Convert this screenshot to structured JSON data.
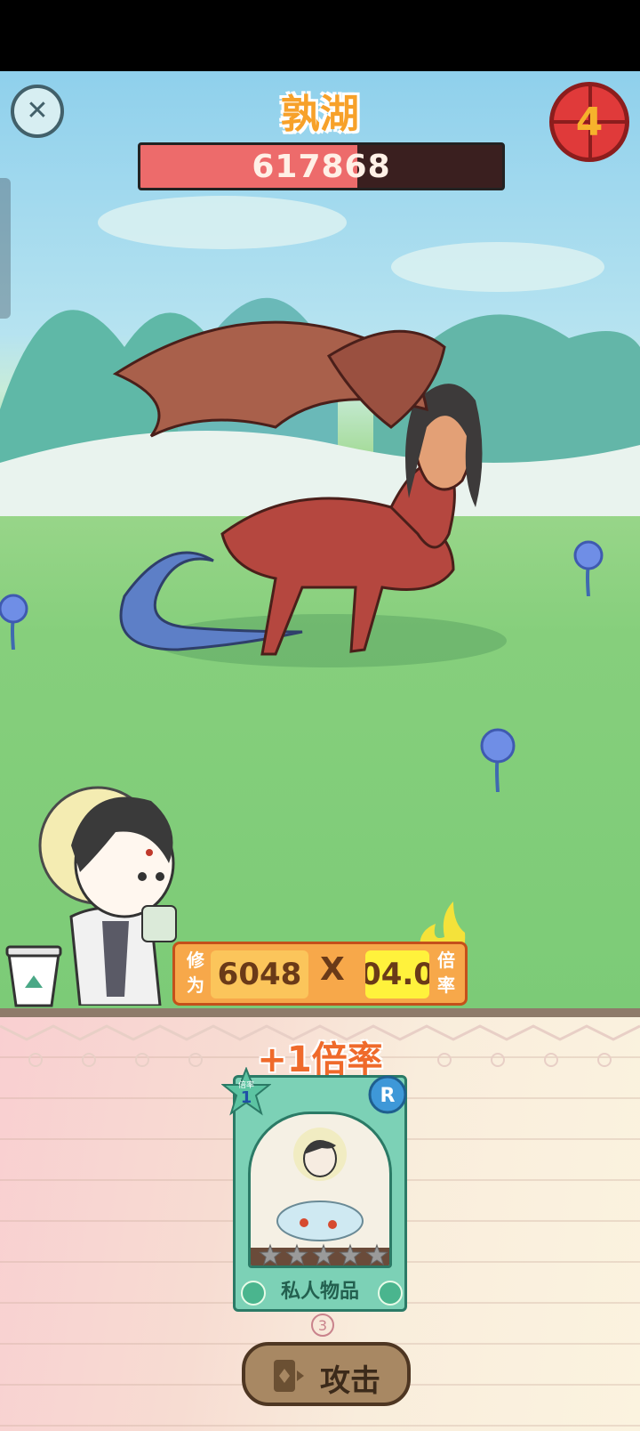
{
  "boss": {
    "name": "孰湖",
    "hp_value": "617868",
    "hp_fraction": 0.6
  },
  "round": {
    "number": "4"
  },
  "stats": {
    "cultivation_label": "修为",
    "cultivation_value": "6048",
    "times_sign": "X",
    "multiplier_label": "倍率",
    "multiplier_value": "04.0"
  },
  "bonus_text": "+1倍率",
  "card": {
    "badge_label": "倍率",
    "badge_value": "1",
    "rarity": "R",
    "title": "私人物品",
    "stars_total": 5,
    "stars_filled": 0
  },
  "deck_count": "3",
  "attack_label": "攻击",
  "colors": {
    "hp_fill": "#ed6b6b",
    "round_badge": "#e03a3a",
    "card_green": "#7cd1b6",
    "attack_btn": "#a88863",
    "panel_orange": "#f7a84a"
  },
  "icons": [
    "close-icon",
    "cup-icon",
    "attack-card-icon"
  ]
}
